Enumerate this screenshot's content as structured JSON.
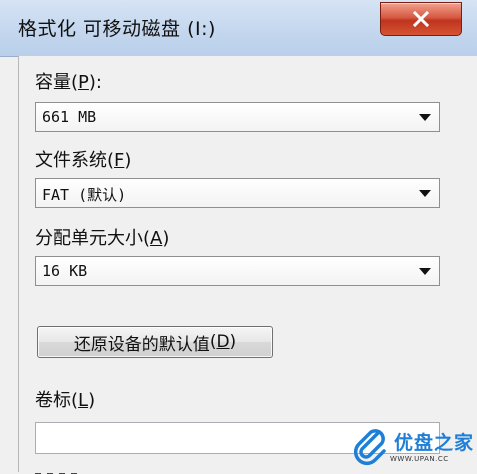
{
  "window": {
    "title": "格式化 可移动磁盘 (I:)"
  },
  "capacity": {
    "label": "容量",
    "hotkey": "P",
    "value": "661 MB"
  },
  "filesystem": {
    "label": "文件系统",
    "hotkey": "F",
    "value": "FAT (默认)"
  },
  "allocation": {
    "label": "分配单元大小",
    "hotkey": "A",
    "value": "16 KB"
  },
  "restore_button": {
    "label": "还原设备的默认值",
    "hotkey": "D"
  },
  "volume_label": {
    "label": "卷标",
    "hotkey": "L",
    "value": ""
  },
  "watermark": {
    "brand": "优盘之家",
    "url": "WWW.UPAN.CC"
  },
  "colors": {
    "title_gradient": "#c3d6ee",
    "close_red": "#c0341e",
    "watermark_blue": "#1f7fd6"
  },
  "icons": [
    "close-icon",
    "chevron-down-icon",
    "paperclip-logo-icon"
  ]
}
